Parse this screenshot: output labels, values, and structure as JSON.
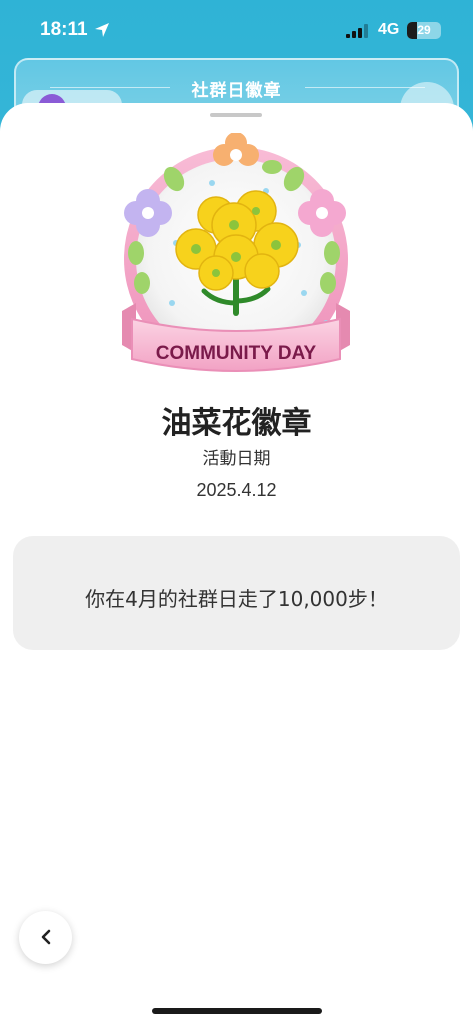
{
  "status_bar": {
    "time": "18:11",
    "network": "4G",
    "battery": "29",
    "battery_level": 0.29
  },
  "background": {
    "header_title": "社群日徽章"
  },
  "badge": {
    "ribbon_text": "COMMUNITY DAY",
    "name": "油菜花徽章",
    "date_label": "活動日期",
    "date": "2025.4.12"
  },
  "message": {
    "text": "你在4月的社群日走了10,000步！"
  },
  "icons": {
    "location": "location-arrow-icon",
    "signal": "cellular-signal-icon",
    "back": "chevron-left-icon"
  },
  "colors": {
    "accent": "#2fb3d6",
    "badge_pink": "#f3a6c6",
    "flower_yellow": "#f7d21c",
    "ribbon_text": "#7a1a4a"
  }
}
